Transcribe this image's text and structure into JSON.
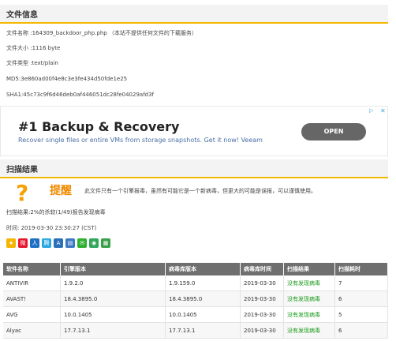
{
  "file_section": {
    "title": "文件信息",
    "rows": [
      "文件名称 :164309_backdoor_php.php （本站不提供任何文件的下载服务）",
      "文件大小 :1116 byte",
      "文件类型 :text/plain",
      "MD5:3e860ad00f4e8c3e3fe434d50fde1e25",
      "SHA1:45c73c9f6d46deb0af446051dc28fe04029afd3f"
    ]
  },
  "ad": {
    "title": "#1 Backup & Recovery",
    "subtitle": "Recover single files or entire VMs from storage snapshots. Get it now! Veeam",
    "button": "OPEN",
    "choices_icon": "info-icon",
    "close_icon": "close-icon"
  },
  "scan_section": {
    "title": "扫描结果",
    "warn_title": "提醒",
    "warn_text": "此文件只有一个引擎报毒，虽然有可能它是一个新病毒，但更大的可能是误报，可以谨慎使用。",
    "result": "扫描结果:2%的杀软(1/49)报告发现病毒",
    "time": "时间: 2019-03-30 23:30:27 (CST)",
    "share_icons": [
      {
        "name": "share-qzone-icon",
        "color": "#f5b400",
        "glyph": "★"
      },
      {
        "name": "share-weibo-icon",
        "color": "#e6162d",
        "glyph": "微"
      },
      {
        "name": "share-renren-icon",
        "color": "#1f6fc5",
        "glyph": "人"
      },
      {
        "name": "share-tencent-icon",
        "color": "#2aa7e0",
        "glyph": "腾"
      },
      {
        "name": "share-douban-icon",
        "color": "#2a70b8",
        "glyph": "A"
      },
      {
        "name": "share-book-icon",
        "color": "#3b78c4",
        "glyph": "▤"
      },
      {
        "name": "share-wechat-icon",
        "color": "#2fb02f",
        "glyph": "✉"
      },
      {
        "name": "share-wechat-moments-icon",
        "color": "#2fa65a",
        "glyph": "◉"
      },
      {
        "name": "share-more-icon",
        "color": "#3aa048",
        "glyph": "▦"
      }
    ]
  },
  "table": {
    "headers": [
      "软件名称",
      "引擎版本",
      "病毒库版本",
      "病毒库时间",
      "扫描结果",
      "扫描耗时"
    ],
    "rows": [
      [
        "ANTIVIR",
        "1.9.2.0",
        "1.9.159.0",
        "2019-03-30",
        "没有发现病毒",
        "7"
      ],
      [
        "AVAST!",
        "18.4.3895.0",
        "18.4.3895.0",
        "2019-03-30",
        "没有发现病毒",
        "6"
      ],
      [
        "AVG",
        "10.0.1405",
        "10.0.1405",
        "2019-03-30",
        "没有发现病毒",
        "5"
      ],
      [
        "Alyac",
        "17.7.13.1",
        "17.7.13.1",
        "2019-03-30",
        "没有发现病毒",
        "6"
      ]
    ]
  }
}
